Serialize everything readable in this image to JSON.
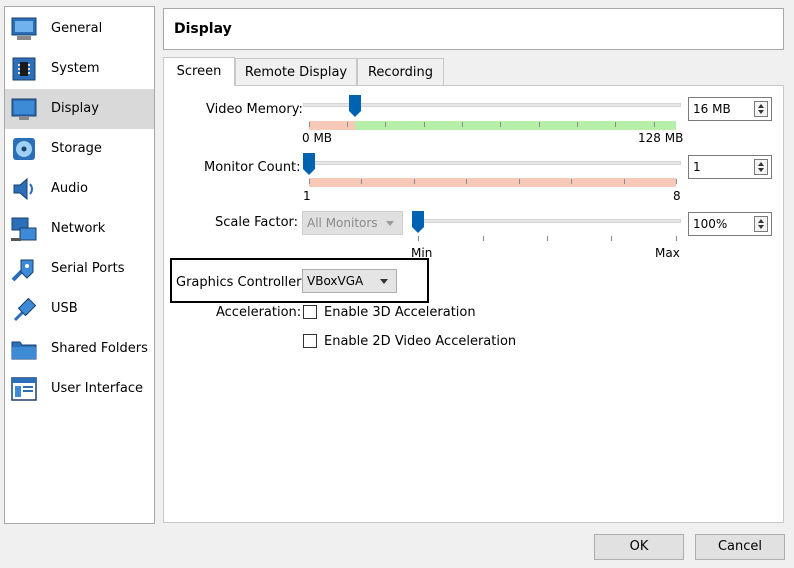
{
  "sidebar": {
    "items": [
      {
        "label": "General",
        "icon": "general-monitor-icon"
      },
      {
        "label": "System",
        "icon": "system-chip-icon"
      },
      {
        "label": "Display",
        "icon": "display-monitor-icon",
        "selected": true
      },
      {
        "label": "Storage",
        "icon": "storage-disk-icon"
      },
      {
        "label": "Audio",
        "icon": "speaker-icon"
      },
      {
        "label": "Network",
        "icon": "network-icon"
      },
      {
        "label": "Serial Ports",
        "icon": "serial-port-icon"
      },
      {
        "label": "USB",
        "icon": "usb-icon"
      },
      {
        "label": "Shared Folders",
        "icon": "folder-icon"
      },
      {
        "label": "User Interface",
        "icon": "window-icon"
      }
    ]
  },
  "header": {
    "title": "Display"
  },
  "tabs": [
    {
      "label": "Screen",
      "active": true
    },
    {
      "label": "Remote Display"
    },
    {
      "label": "Recording"
    }
  ],
  "screen": {
    "video_memory": {
      "label": "Video Memory:",
      "min_label": "0 MB",
      "max_label": "128 MB",
      "value_text": "16 MB",
      "value": 16,
      "min": 0,
      "max": 128
    },
    "monitor_count": {
      "label": "Monitor Count:",
      "min_label": "1",
      "max_label": "8",
      "value_text": "1",
      "value": 1,
      "min": 1,
      "max": 8
    },
    "scale_factor": {
      "label": "Scale Factor:",
      "monitor_select": "All Monitors",
      "min_label": "Min",
      "max_label": "Max",
      "value_text": "100%"
    },
    "graphics_controller": {
      "label": "Graphics Controller:",
      "value": "VBoxVGA"
    },
    "acceleration": {
      "label": "Acceleration:",
      "enable_3d": "Enable 3D Acceleration",
      "enable_2d": "Enable 2D Video Acceleration",
      "enable_3d_checked": false,
      "enable_2d_checked": false
    }
  },
  "buttons": {
    "ok": "OK",
    "cancel": "Cancel"
  },
  "colors": {
    "accent": "#0063b1",
    "selected_bg": "#d9d9d9",
    "good_band": "#b6f0a8",
    "warn_band": "#f8c8b8"
  }
}
